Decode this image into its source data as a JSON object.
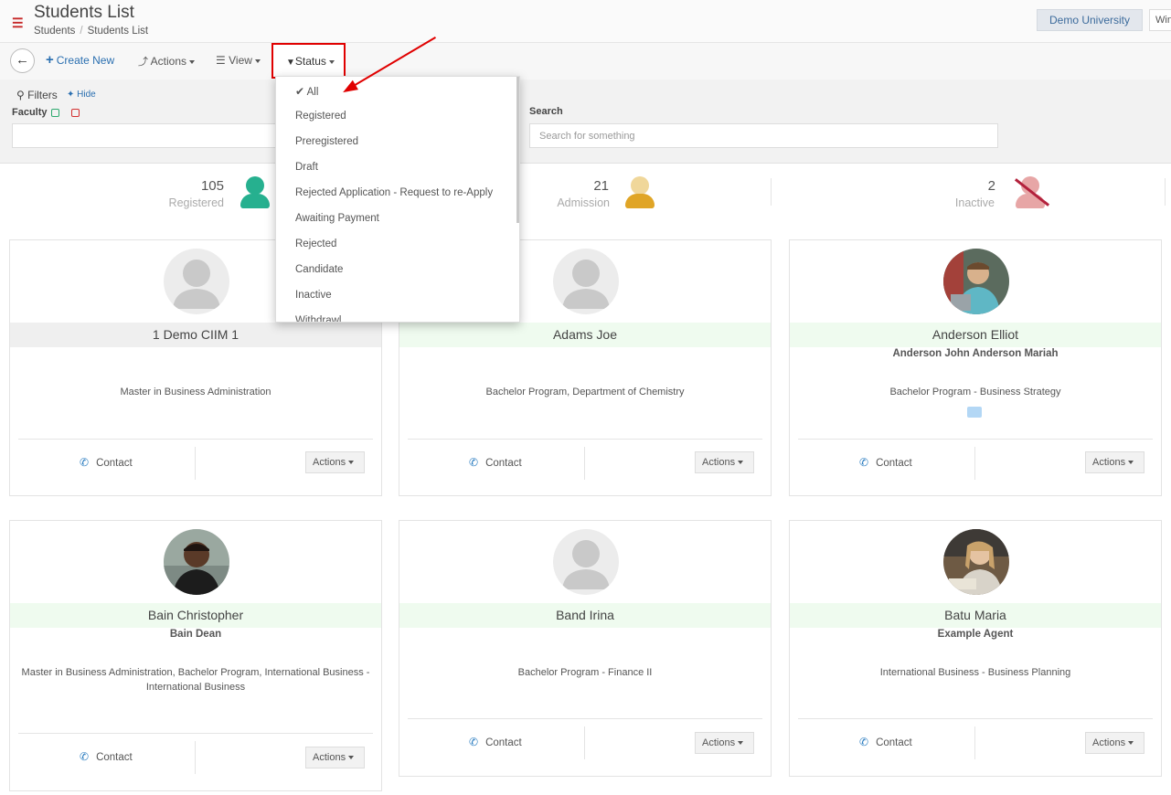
{
  "header": {
    "title": "Students List",
    "breadcrumb": [
      "Students",
      "Students List"
    ],
    "university": "Demo University",
    "window_tab": "Win"
  },
  "toolbar": {
    "create_new": "Create New",
    "actions": "Actions",
    "view": "View",
    "status": "Status"
  },
  "filters": {
    "label": "Filters",
    "hide": "Hide",
    "faculty_label": "Faculty",
    "search_label": "Search",
    "search_placeholder": "Search for something"
  },
  "stats": [
    {
      "value": "105",
      "label": "Registered",
      "color": "#26b08f"
    },
    {
      "value": "21",
      "label": "Admission",
      "color": "#e0a526"
    },
    {
      "value": "2",
      "label": "Inactive",
      "color": "#e7a6a6"
    }
  ],
  "status_menu": {
    "items": [
      "All",
      "Registered",
      "Preregistered",
      "Draft",
      "Rejected Application - Request to re-Apply",
      "Awaiting Payment",
      "Rejected",
      "Candidate",
      "Inactive",
      "Withdrawl"
    ],
    "selected": "All"
  },
  "cards": [
    {
      "name": "1 Demo CIIM 1",
      "agent": "",
      "program": "Master in Business Administration",
      "contact": "Contact",
      "actions": "Actions"
    },
    {
      "name": "Adams Joe",
      "agent": "",
      "program": "Bachelor Program, Department of Chemistry",
      "contact": "Contact",
      "actions": "Actions"
    },
    {
      "name": "Anderson Elliot",
      "agent": "Anderson John Anderson Mariah",
      "program": "Bachelor Program  -  Business Strategy",
      "contact": "Contact",
      "actions": "Actions"
    },
    {
      "name": "Bain Christopher",
      "agent": "Bain Dean",
      "program": "Master in Business Administration, Bachelor Program, International Business  -  International Business",
      "contact": "Contact",
      "actions": "Actions"
    },
    {
      "name": "Band Irina",
      "agent": "",
      "program": "Bachelor Program  -  Finance II",
      "contact": "Contact",
      "actions": "Actions"
    },
    {
      "name": "Batu Maria",
      "agent": "Example Agent",
      "program": "International Business  -  Business Planning",
      "contact": "Contact",
      "actions": "Actions"
    }
  ],
  "colors": {
    "accent": "#2a6fb0",
    "highlight": "#e00000",
    "name_bar_default": "#efefef",
    "name_bar_active": "#effbef"
  }
}
